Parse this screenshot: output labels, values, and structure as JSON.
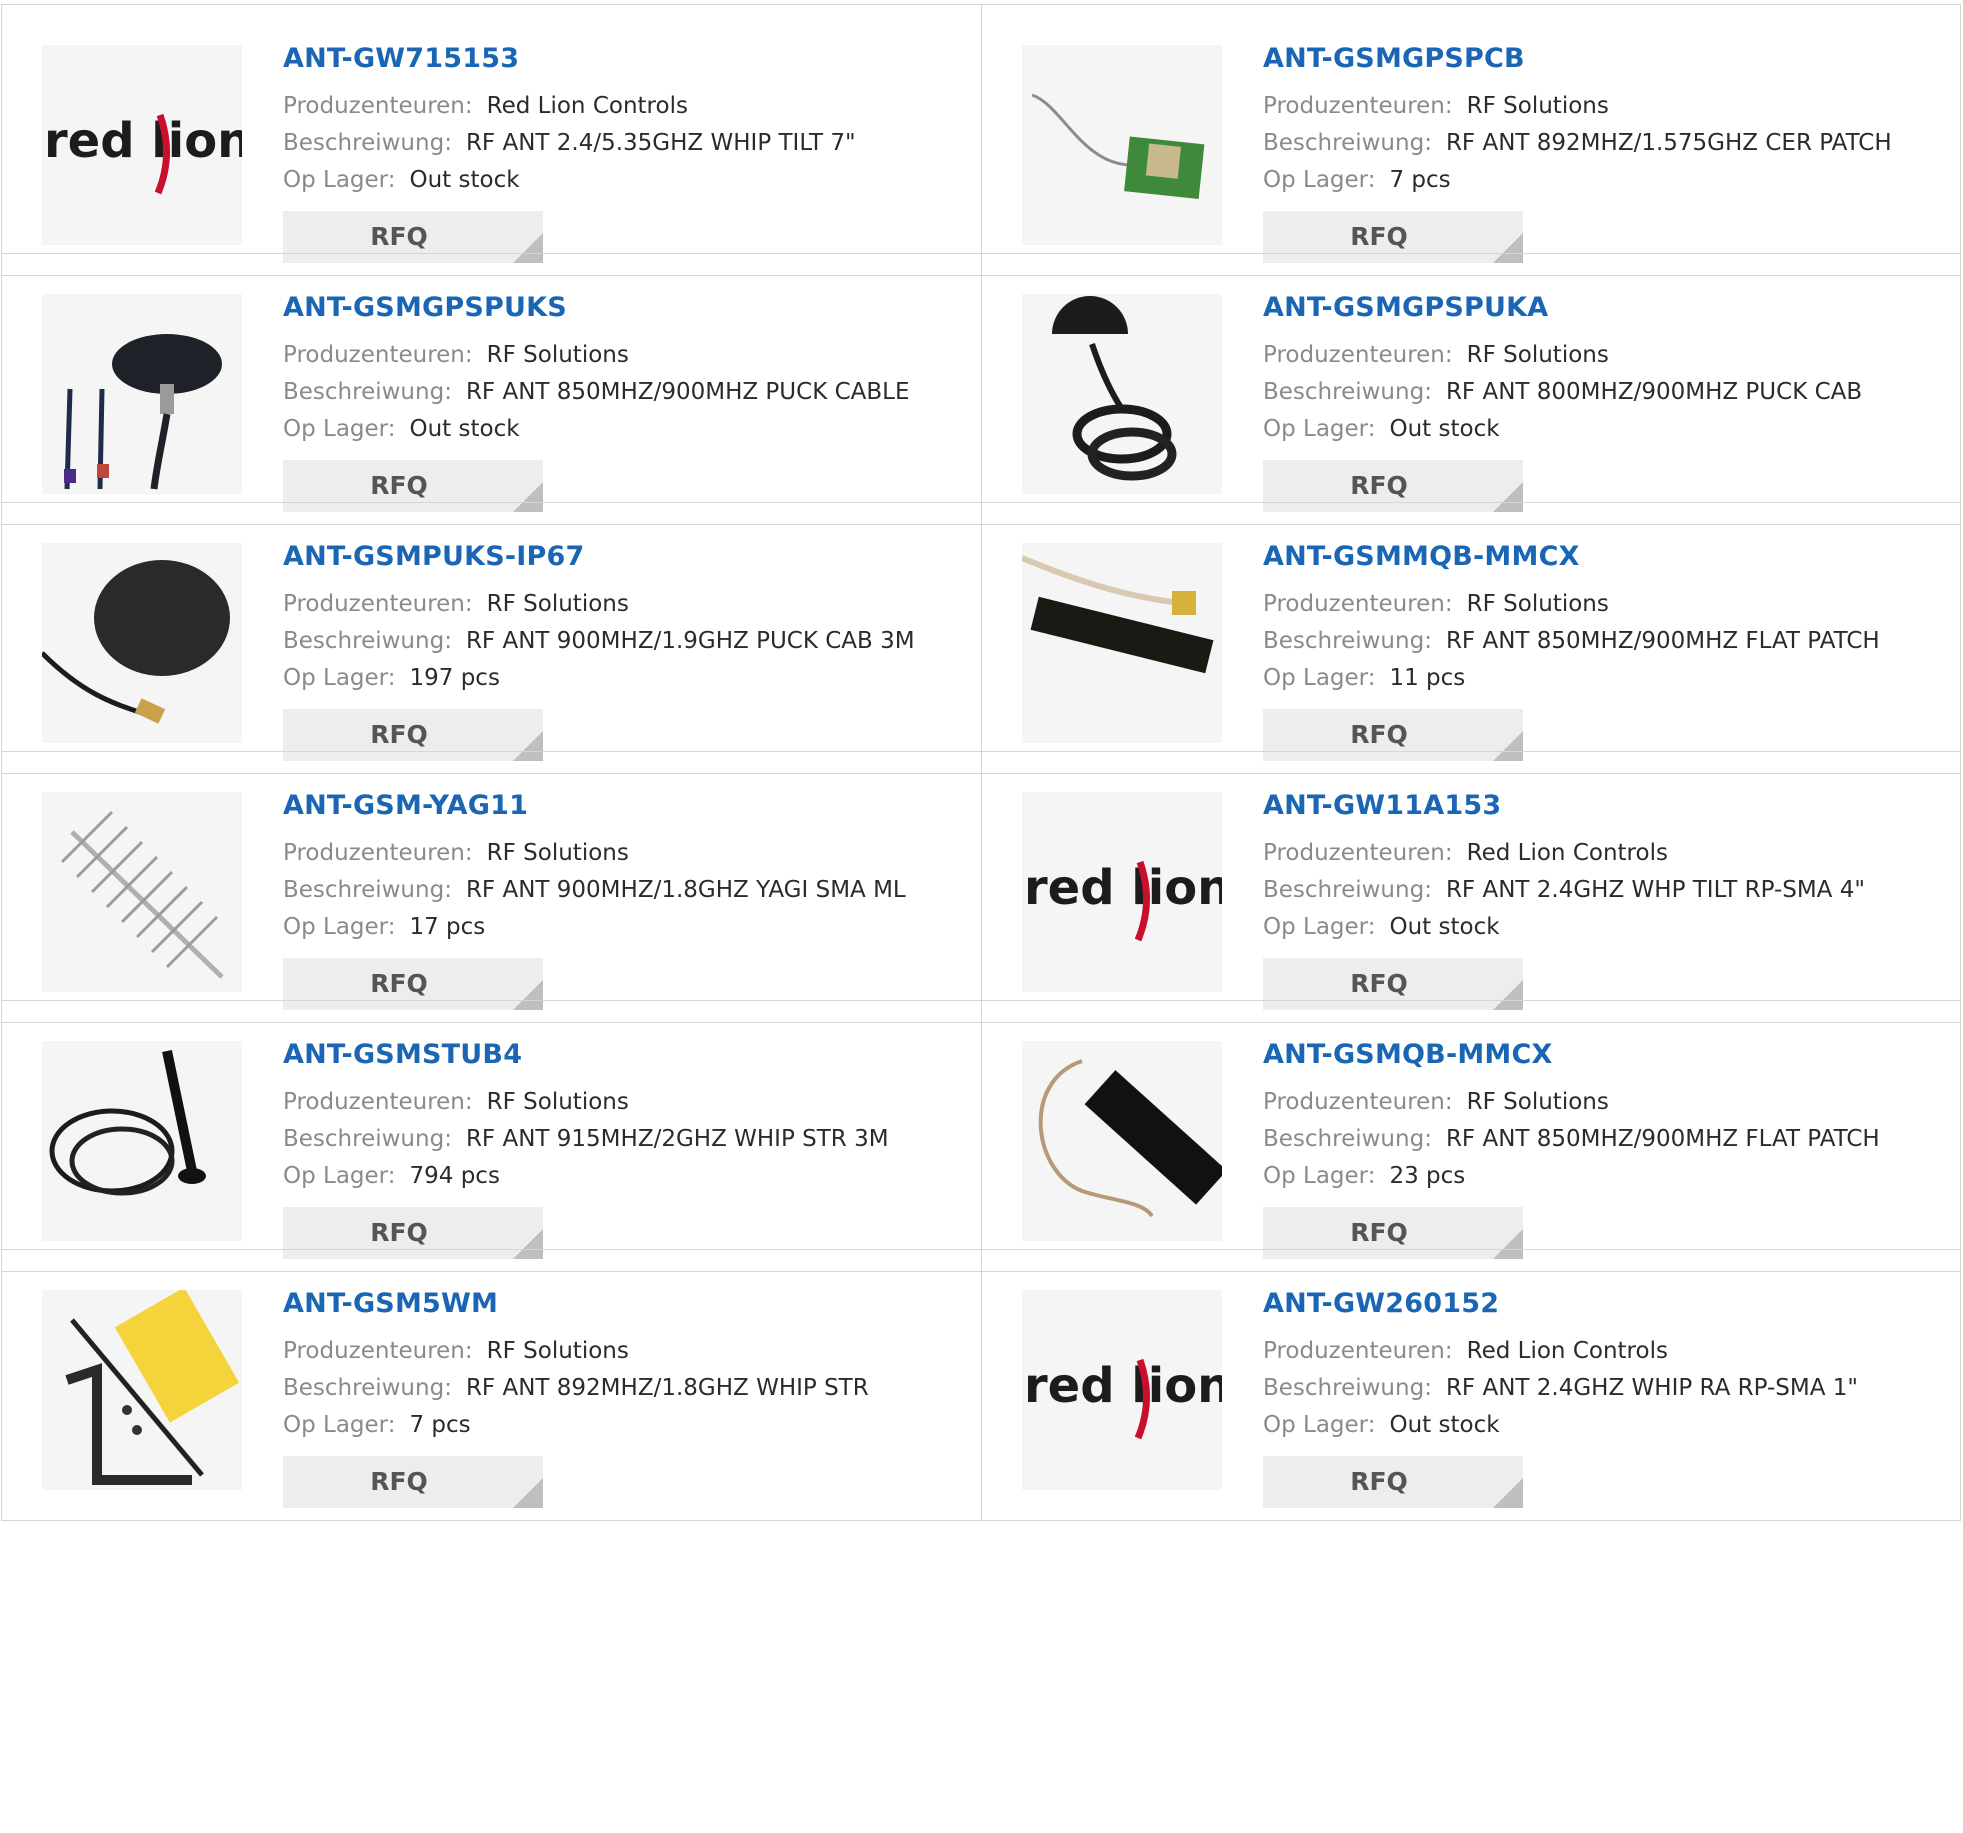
{
  "labels": {
    "manufacturer": "Produzenteuren:",
    "description": "Beschreiwung:",
    "stock": "Op Lager:",
    "rfq": "RFQ"
  },
  "logo_text": "red lion",
  "colors": {
    "link": "#1a66b4",
    "button_bg": "#ededed",
    "border": "#d6d6d6",
    "label": "#8a8a8a"
  },
  "products": [
    {
      "part": "ANT-GW715153",
      "manufacturer": "Red Lion Controls",
      "description": "RF ANT 2.4/5.35GHZ WHIP TILT 7\"",
      "stock": "Out stock",
      "image": "red-lion-logo"
    },
    {
      "part": "ANT-GSMGPSPCB",
      "manufacturer": "RF Solutions",
      "description": "RF ANT 892MHZ/1.575GHZ CER PATCH",
      "stock": "7 pcs",
      "image": "pcb-patch-antenna"
    },
    {
      "part": "ANT-GSMGPSPUKS",
      "manufacturer": "RF Solutions",
      "description": "RF ANT 850MHZ/900MHZ PUCK CABLE",
      "stock": "Out stock",
      "image": "puck-antenna-cables"
    },
    {
      "part": "ANT-GSMGPSPUKA",
      "manufacturer": "RF Solutions",
      "description": "RF ANT 800MHZ/900MHZ PUCK CAB",
      "stock": "Out stock",
      "image": "puck-antenna-coiled"
    },
    {
      "part": "ANT-GSMPUKS-IP67",
      "manufacturer": "RF Solutions",
      "description": "RF ANT 900MHZ/1.9GHZ PUCK CAB 3M",
      "stock": "197 pcs",
      "image": "puck-antenna-ip67"
    },
    {
      "part": "ANT-GSMMQB-MMCX",
      "manufacturer": "RF Solutions",
      "description": "RF ANT 850MHZ/900MHZ FLAT PATCH",
      "stock": "11 pcs",
      "image": "flat-patch-antenna"
    },
    {
      "part": "ANT-GSM-YAG11",
      "manufacturer": "RF Solutions",
      "description": "RF ANT 900MHZ/1.8GHZ YAGI SMA ML",
      "stock": "17 pcs",
      "image": "yagi-antenna"
    },
    {
      "part": "ANT-GW11A153",
      "manufacturer": "Red Lion Controls",
      "description": "RF ANT 2.4GHZ WHP TILT RP-SMA 4\"",
      "stock": "Out stock",
      "image": "red-lion-logo"
    },
    {
      "part": "ANT-GSMSTUB4",
      "manufacturer": "RF Solutions",
      "description": "RF ANT 915MHZ/2GHZ WHIP STR 3M",
      "stock": "794 pcs",
      "image": "stub-antenna-cable"
    },
    {
      "part": "ANT-GSMQB-MMCX",
      "manufacturer": "RF Solutions",
      "description": "RF ANT 850MHZ/900MHZ FLAT PATCH",
      "stock": "23 pcs",
      "image": "black-flat-antenna"
    },
    {
      "part": "ANT-GSM5WM",
      "manufacturer": "RF Solutions",
      "description": "RF ANT 892MHZ/1.8GHZ WHIP STR",
      "stock": "7 pcs",
      "image": "whip-bracket-kit"
    },
    {
      "part": "ANT-GW260152",
      "manufacturer": "Red Lion Controls",
      "description": "RF ANT 2.4GHZ WHIP RA RP-SMA 1\"",
      "stock": "Out stock",
      "image": "red-lion-logo"
    }
  ]
}
